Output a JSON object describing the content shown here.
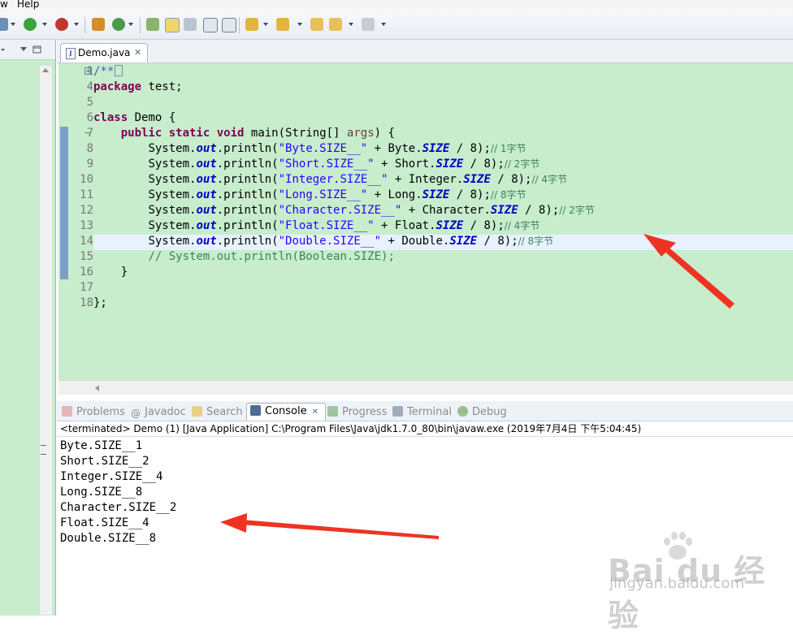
{
  "menubar": {
    "items": [
      {
        "label": "w"
      },
      {
        "label": "Help"
      }
    ]
  },
  "toolbar": {
    "icons": [
      "new-icon",
      "run-icon",
      "debug-icon",
      "build-icon",
      "refresh-icon",
      "open-type-icon",
      "toggle-mark-icon",
      "open-task-icon",
      "next-annotation-icon",
      "prev-annotation-icon",
      "back-icon",
      "forward-icon"
    ]
  },
  "editor": {
    "tab_label": "Demo.java",
    "lines": [
      {
        "no": "1"
      },
      {
        "no": "4"
      },
      {
        "no": "5"
      },
      {
        "no": "6"
      },
      {
        "no": "7"
      },
      {
        "no": "8"
      },
      {
        "no": "9"
      },
      {
        "no": "10"
      },
      {
        "no": "11"
      },
      {
        "no": "12"
      },
      {
        "no": "13"
      },
      {
        "no": "14"
      },
      {
        "no": "15"
      },
      {
        "no": "16"
      },
      {
        "no": "17"
      },
      {
        "no": "18"
      }
    ],
    "code": {
      "l1": "/**",
      "l4_kw": "package",
      "l4_rest": " test;",
      "l6_kw": "class",
      "l6_rest": " Demo {",
      "l7_kw1": "public",
      "l7_kw2": "static",
      "l7_kw3": "void",
      "l7_rest": " main(String[] ",
      "l7_args": "args",
      "l7_end": ") {",
      "sys": "System.",
      "out": "out",
      "println": ".println(",
      "rows": [
        {
          "str": "\"Byte.SIZE__\"",
          "plus": " + Byte.",
          "size": "SIZE",
          "tail": " / 8);",
          "comment": "// 1字节"
        },
        {
          "str": "\"Short.SIZE__\"",
          "plus": " + Short.",
          "size": "SIZE",
          "tail": " / 8);",
          "comment": "// 2字节"
        },
        {
          "str": "\"Integer.SIZE__\"",
          "plus": " + Integer.",
          "size": "SIZE",
          "tail": " / 8);",
          "comment": "// 4字节"
        },
        {
          "str": "\"Long.SIZE__\"",
          "plus": " + Long.",
          "size": "SIZE",
          "tail": " / 8);",
          "comment": "// 8字节"
        },
        {
          "str": "\"Character.SIZE__\"",
          "plus": " + Character.",
          "size": "SIZE",
          "tail": " / 8);",
          "comment": "// 2字节"
        },
        {
          "str": "\"Float.SIZE__\"",
          "plus": " + Float.",
          "size": "SIZE",
          "tail": " / 8);",
          "comment": "// 4字节"
        },
        {
          "str": "\"Double.SIZE__\"",
          "plus": " + Double.",
          "size": "SIZE",
          "tail": " / 8);",
          "comment": "// 8字节"
        }
      ],
      "l15": "// System.out.println(Boolean.SIZE);",
      "l16": "}",
      "l18": "};"
    }
  },
  "console": {
    "tabs": [
      {
        "label": "Problems",
        "active": false
      },
      {
        "label": "Javadoc",
        "active": false
      },
      {
        "label": "Search",
        "active": false
      },
      {
        "label": "Console",
        "active": true
      },
      {
        "label": "Progress",
        "active": false
      },
      {
        "label": "Terminal",
        "active": false
      },
      {
        "label": "Debug",
        "active": false
      }
    ],
    "header": "<terminated> Demo (1) [Java Application] C:\\Program Files\\Java\\jdk1.7.0_80\\bin\\javaw.exe (2019年7月4日 下午5:04:45)",
    "output": [
      "Byte.SIZE__1",
      "Short.SIZE__2",
      "Integer.SIZE__4",
      "Long.SIZE__8",
      "Character.SIZE__2",
      "Float.SIZE__4",
      "Double.SIZE__8"
    ]
  },
  "watermark": {
    "brand": "Bai du 经验",
    "url": "jingyan.baidu.com"
  },
  "colors": {
    "editor_bg": "#c7edcc",
    "keyword": "#7f0055",
    "string": "#2a00ff",
    "field": "#0000c0",
    "comment": "#3f7f5f",
    "arrow": "#ee3322"
  }
}
